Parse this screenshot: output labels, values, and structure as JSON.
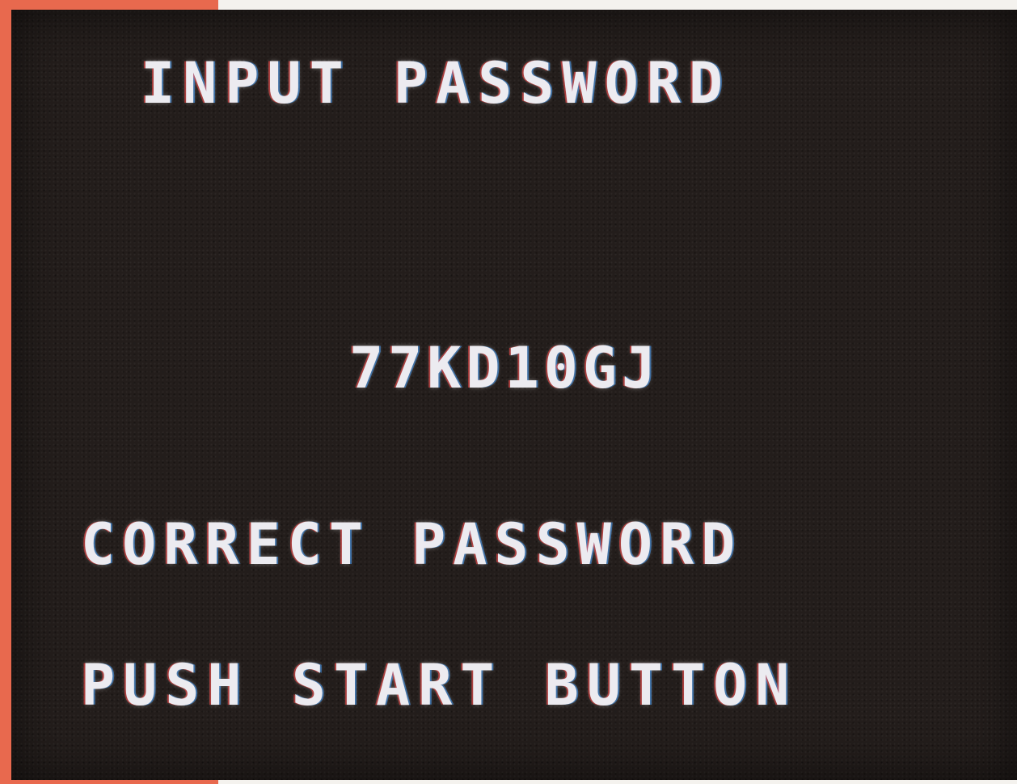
{
  "screen": {
    "title": "INPUT PASSWORD",
    "password": "77KD10GJ",
    "status": "CORRECT PASSWORD",
    "prompt": "PUSH START BUTTON"
  },
  "colors": {
    "screen_background": "#231d1b",
    "text": "#ecebf0",
    "left_edge": "#e8694e"
  }
}
